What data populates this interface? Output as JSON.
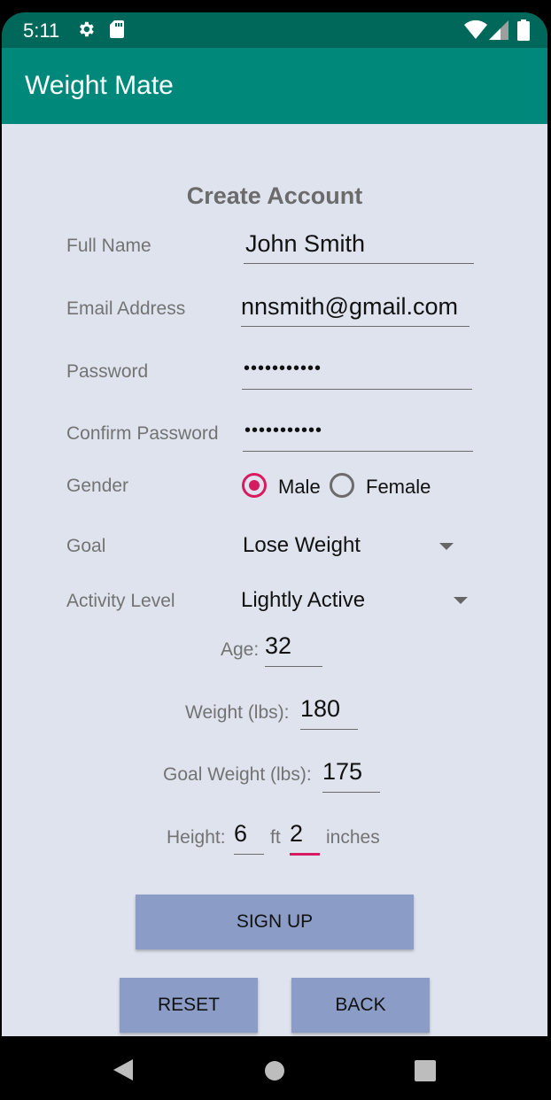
{
  "status": {
    "time": "5:11"
  },
  "app": {
    "title": "Weight Mate"
  },
  "form": {
    "heading": "Create Account",
    "full_name": {
      "label": "Full Name",
      "value": "John Smith"
    },
    "email": {
      "label": "Email Address",
      "value": "nnsmith@gmail.com"
    },
    "password": {
      "label": "Password",
      "value": "•••••••••••"
    },
    "confirm_password": {
      "label": "Confirm Password",
      "value": "•••••••••••"
    },
    "gender": {
      "label": "Gender",
      "options": [
        "Male",
        "Female"
      ],
      "selected": "Male"
    },
    "goal": {
      "label": "Goal",
      "value": "Lose Weight"
    },
    "activity": {
      "label": "Activity Level",
      "value": "Lightly Active"
    },
    "age": {
      "label": "Age:",
      "value": "32"
    },
    "weight": {
      "label": "Weight (lbs):",
      "value": "180"
    },
    "goal_weight": {
      "label": "Goal Weight (lbs):",
      "value": "175"
    },
    "height": {
      "label": "Height:",
      "feet": "6",
      "feet_unit": "ft",
      "inches": "2",
      "inches_unit": "inches"
    }
  },
  "buttons": {
    "sign_up": "SIGN UP",
    "reset": "RESET",
    "back": "BACK"
  },
  "colors": {
    "app_bar": "#00897b",
    "status_bar": "#00675b",
    "accent": "#d81b60",
    "button": "#8b9dc6",
    "background": "#dfe3ee"
  }
}
